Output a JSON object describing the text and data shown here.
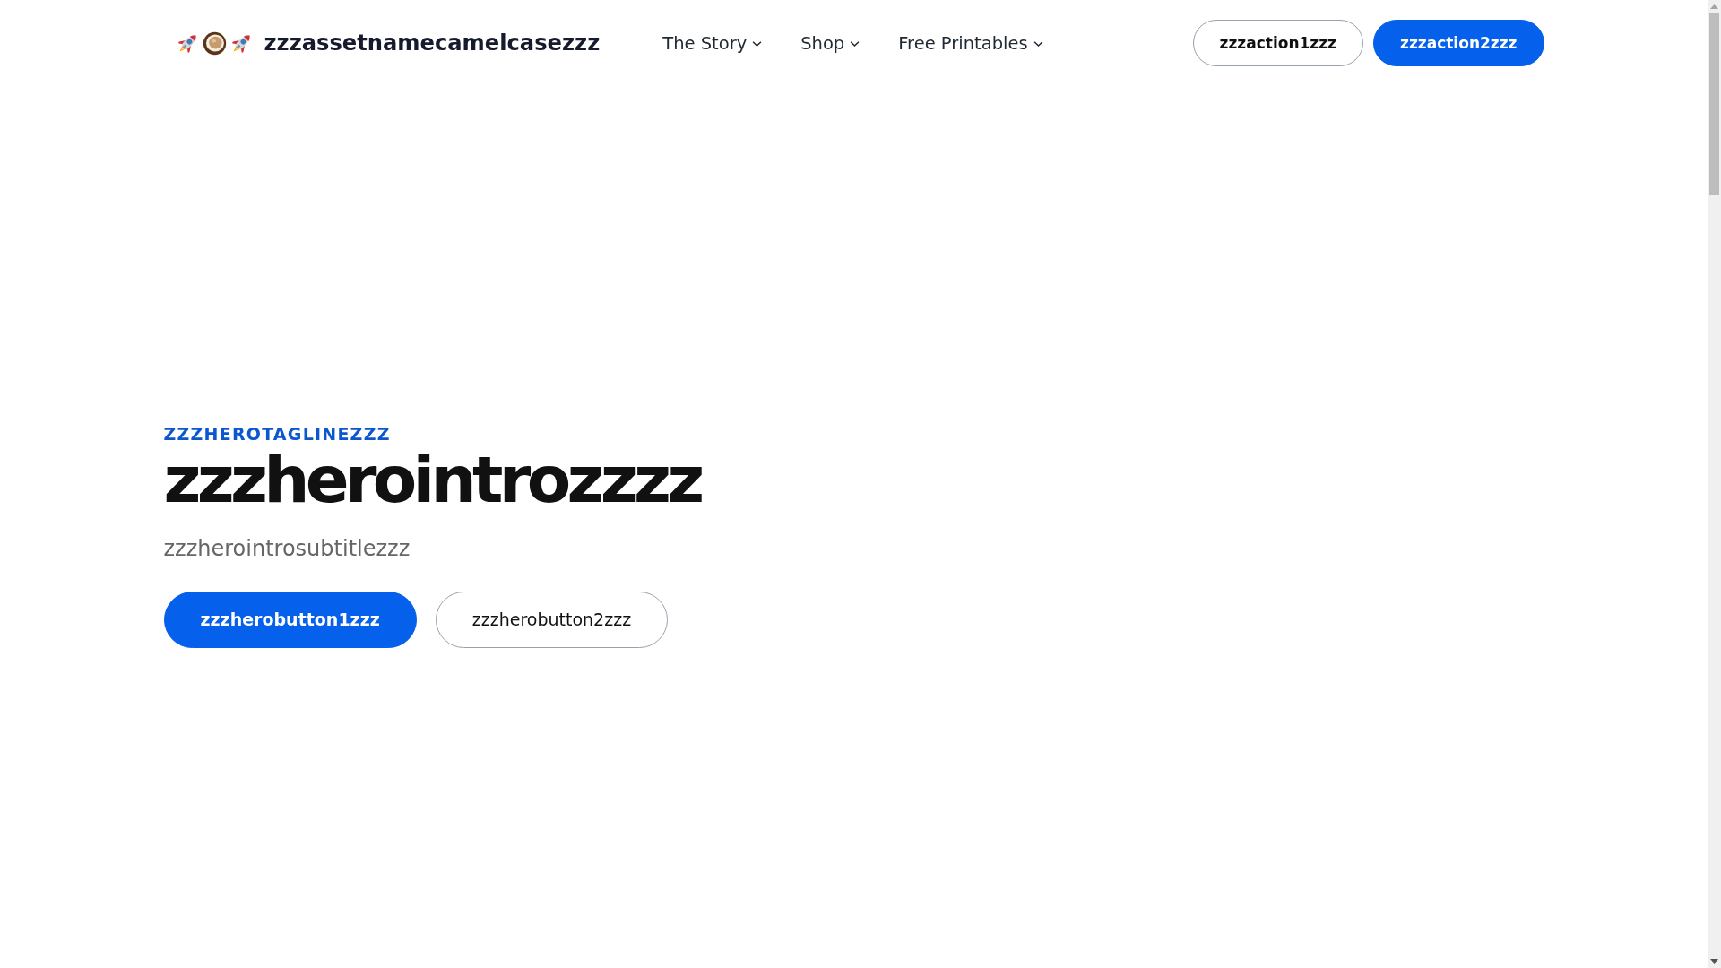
{
  "header": {
    "logo": {
      "text": "zzzassetnamecamelcasezzz"
    },
    "nav": [
      {
        "label": "The Story",
        "dropdown": true
      },
      {
        "label": "Shop",
        "dropdown": true
      },
      {
        "label": "Free Printables",
        "dropdown": true
      }
    ],
    "actions": [
      {
        "label": "zzzaction1zzz",
        "kind": "outline"
      },
      {
        "label": "zzzaction2zzz",
        "kind": "primary"
      }
    ]
  },
  "hero": {
    "tagline": "ZZZHEROTAGLINEZZZ",
    "title": "zzzherointrozzzz",
    "subtitle": "zzzherointrosubtitlezzz",
    "buttons": [
      {
        "label": "zzzherobutton1zzz",
        "kind": "primary"
      },
      {
        "label": "zzzherobutton2zzz",
        "kind": "outline"
      }
    ]
  }
}
